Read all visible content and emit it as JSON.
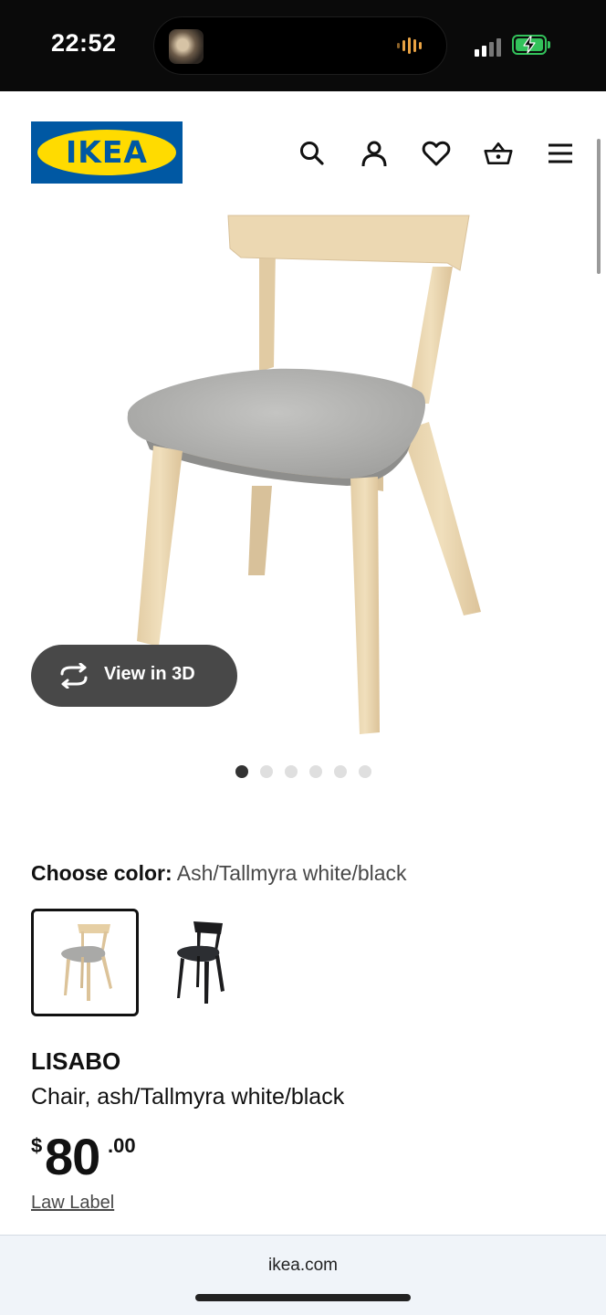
{
  "status_bar": {
    "time": "22:52",
    "now_playing_icon": "album-art-thumbnail",
    "audio_icon": "waveform-icon",
    "signal_icon": "cellular-signal-icon",
    "battery_icon": "battery-charging-icon",
    "battery_color": "#33c25b"
  },
  "header": {
    "logo_text": "IKEA",
    "brand_blue": "#0058a3",
    "brand_yellow": "#ffdb00",
    "icons": [
      "search-icon",
      "account-icon",
      "heart-icon",
      "basket-icon",
      "menu-icon"
    ]
  },
  "gallery": {
    "view3d_label": "View in 3D",
    "view3d_icon": "rotate-3d-icon",
    "image_count": 6,
    "active_index": 0
  },
  "color_chooser": {
    "label": "Choose color:",
    "selected_value": "Ash/Tallmyra white/black",
    "options": [
      "ash-gray",
      "black"
    ]
  },
  "product": {
    "name": "LISABO",
    "description": "Chair, ash/Tallmyra white/black",
    "price_currency": "$",
    "price_integer": "80",
    "price_decimal": ".00",
    "law_label": "Law Label"
  },
  "browser": {
    "url": "ikea.com"
  }
}
